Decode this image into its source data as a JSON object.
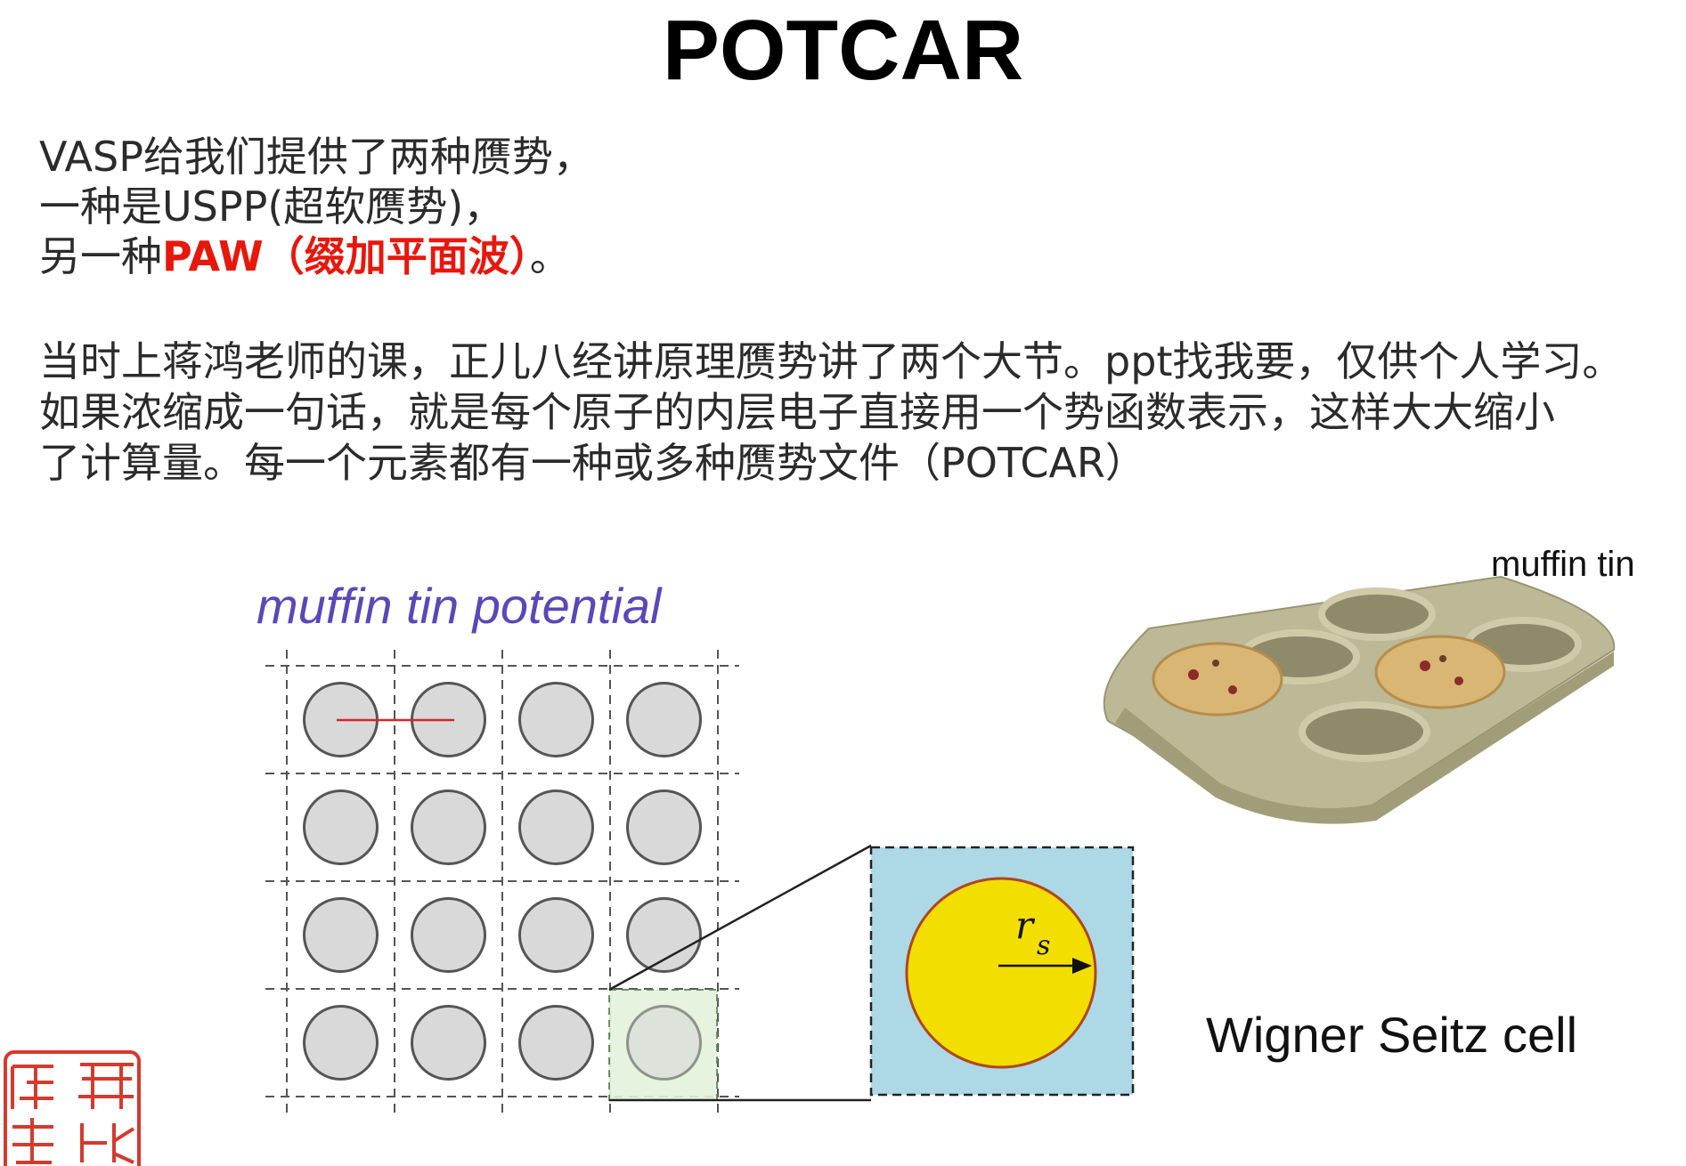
{
  "title": "POTCAR",
  "intro": {
    "line1": "VASP给我们提供了两种赝势，",
    "line2": "一种是USPP(超软赝势)，",
    "line3_prefix": "另一种",
    "line3_red": "PAW（缀加平面波）",
    "line3_suffix": "。"
  },
  "paragraph": {
    "line1": "当时上蒋鸿老师的课，正儿八经讲原理赝势讲了两个大节。ppt找我要，仅供个人学习。",
    "line2": "如果浓缩成一句话，就是每个原子的内层电子直接用一个势函数表示，这样大大缩小",
    "line3": "了计算量。每一个元素都有一种或多种赝势文件（POTCAR）"
  },
  "figure": {
    "muffin_tin_potential_label": "muffin tin potential",
    "muffin_tin_label": "muffin tin",
    "wigner_seitz_label": "Wigner Seitz cell",
    "rs_symbol": "r",
    "rs_subscript": "s",
    "grid_rows": 4,
    "grid_cols": 4,
    "colors": {
      "label_purple": "#5b47b8",
      "circle_fill": "#d9d9d9",
      "circle_stroke": "#555555",
      "cell_fill": "#add8e6",
      "sphere_fill": "#f2de00",
      "sphere_stroke": "#b0461e",
      "radius_line": "#d7262a",
      "highlight": "#e3f2dc",
      "tray": "#b9b48f"
    }
  },
  "seal_text": [
    "成",
    "研",
    "理",
    "北"
  ],
  "colors": {
    "title": "#000000",
    "body_text": "#2b2b2b",
    "accent_red": "#e8170c"
  }
}
